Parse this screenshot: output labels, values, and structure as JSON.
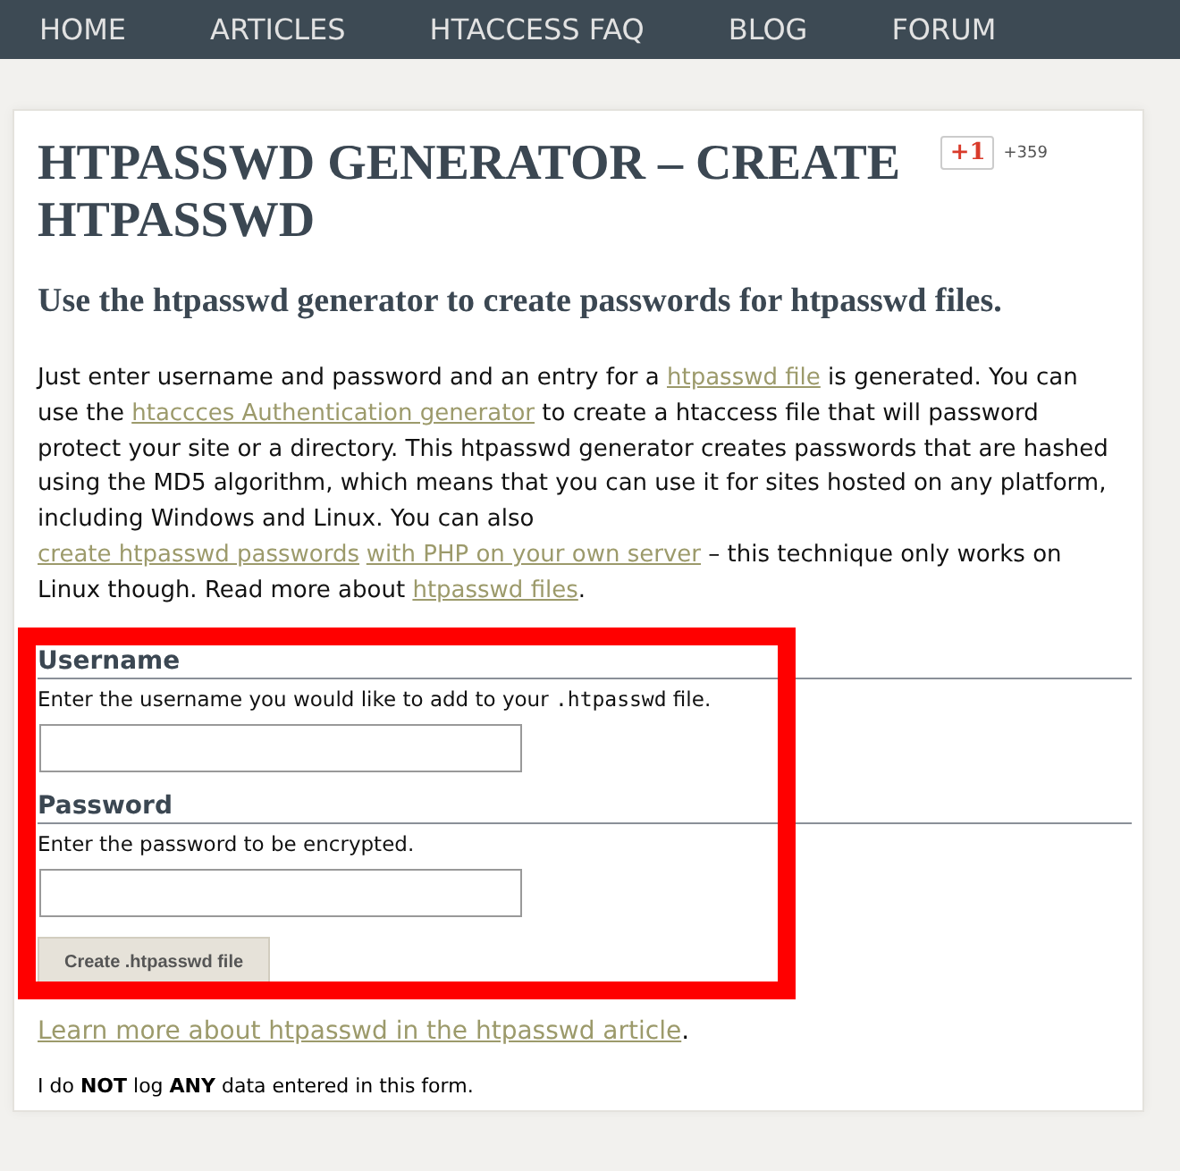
{
  "nav": [
    {
      "label": "HOME"
    },
    {
      "label": "ARTICLES"
    },
    {
      "label": "HTACCESS FAQ"
    },
    {
      "label": "BLOG"
    },
    {
      "label": "FORUM"
    }
  ],
  "title": "HTPASSWD GENERATOR – CREATE HTPASSWD",
  "plusone": {
    "label": "+1",
    "count": "+359"
  },
  "subtitle": "Use the htpasswd generator to create passwords for htpasswd files.",
  "intro": [
    {
      "kind": "text",
      "text": "Just enter username and password and an entry for a "
    },
    {
      "kind": "link",
      "text": "htpasswd file"
    },
    {
      "kind": "text",
      "text": " is generated. You can use the "
    },
    {
      "kind": "link",
      "text": "htaccces Authentication generator"
    },
    {
      "kind": "text",
      "text": " to create a htaccess file that will password protect your site or a directory. This htpasswd generator creates passwords that are hashed using the MD5 algorithm, which means that you can use it for sites hosted on any platform, including Windows and Linux. You can also "
    },
    {
      "kind": "link",
      "text": "create htpasswd passwords"
    },
    {
      "kind": "link",
      "text": "with PHP on your own server"
    },
    {
      "kind": "text",
      "text": " – this technique only works on Linux though. Read more about "
    },
    {
      "kind": "link",
      "text": "htpasswd files"
    },
    {
      "kind": "text",
      "text": "."
    }
  ],
  "form": {
    "highlighted": true,
    "fields": [
      {
        "label": "Username",
        "hint": [
          {
            "kind": "text",
            "text": "Enter the username you would like to add to your "
          },
          {
            "kind": "code",
            "text": ".htpasswd"
          },
          {
            "kind": "text",
            "text": " file."
          }
        ]
      },
      {
        "label": "Password",
        "hint": [
          {
            "kind": "text",
            "text": "Enter the password to be encrypted."
          }
        ]
      }
    ],
    "button": "Create .htpasswd file"
  },
  "more_link": "Learn more about htpasswd in the htpasswd article",
  "more_tail": ".",
  "notice": "I do **NOT** log **ANY** data entered in this form."
}
